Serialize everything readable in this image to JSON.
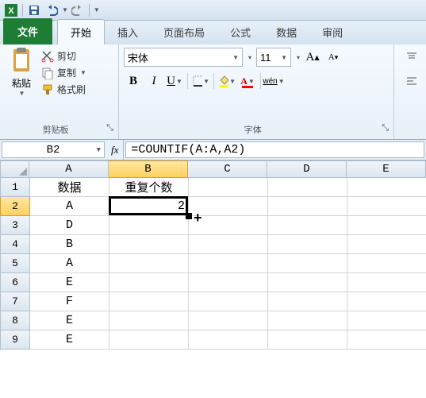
{
  "qat": {
    "save": "save-icon",
    "undo": "undo-icon",
    "redo": "redo-icon"
  },
  "tabs": {
    "file": "文件",
    "items": [
      "开始",
      "插入",
      "页面布局",
      "公式",
      "数据",
      "审阅"
    ],
    "active": 0
  },
  "clipboard": {
    "paste": "粘贴",
    "cut": "剪切",
    "copy": "复制",
    "format_painter": "格式刷",
    "group_title": "剪贴板"
  },
  "font": {
    "name": "宋体",
    "size": "11",
    "grow_label": "A",
    "shrink_label": "A",
    "bold": "B",
    "italic": "I",
    "underline": "U",
    "phonetic": "wén",
    "group_title": "字体"
  },
  "namebox": "B2",
  "fx_label": "fx",
  "formula": "=COUNTIF(A:A,A2)",
  "columns": [
    "A",
    "B",
    "C",
    "D",
    "E"
  ],
  "selected_col_index": 1,
  "rows": [
    {
      "n": "1",
      "cells": [
        "数据",
        "重复个数",
        "",
        "",
        ""
      ]
    },
    {
      "n": "2",
      "cells": [
        "A",
        "2",
        "",
        "",
        ""
      ],
      "sel": true
    },
    {
      "n": "3",
      "cells": [
        "D",
        "",
        "",
        "",
        ""
      ]
    },
    {
      "n": "4",
      "cells": [
        "B",
        "",
        "",
        "",
        ""
      ]
    },
    {
      "n": "5",
      "cells": [
        "A",
        "",
        "",
        "",
        ""
      ]
    },
    {
      "n": "6",
      "cells": [
        "E",
        "",
        "",
        "",
        ""
      ]
    },
    {
      "n": "7",
      "cells": [
        "F",
        "",
        "",
        "",
        ""
      ]
    },
    {
      "n": "8",
      "cells": [
        "E",
        "",
        "",
        "",
        ""
      ]
    },
    {
      "n": "9",
      "cells": [
        "E",
        "",
        "",
        "",
        ""
      ]
    }
  ]
}
